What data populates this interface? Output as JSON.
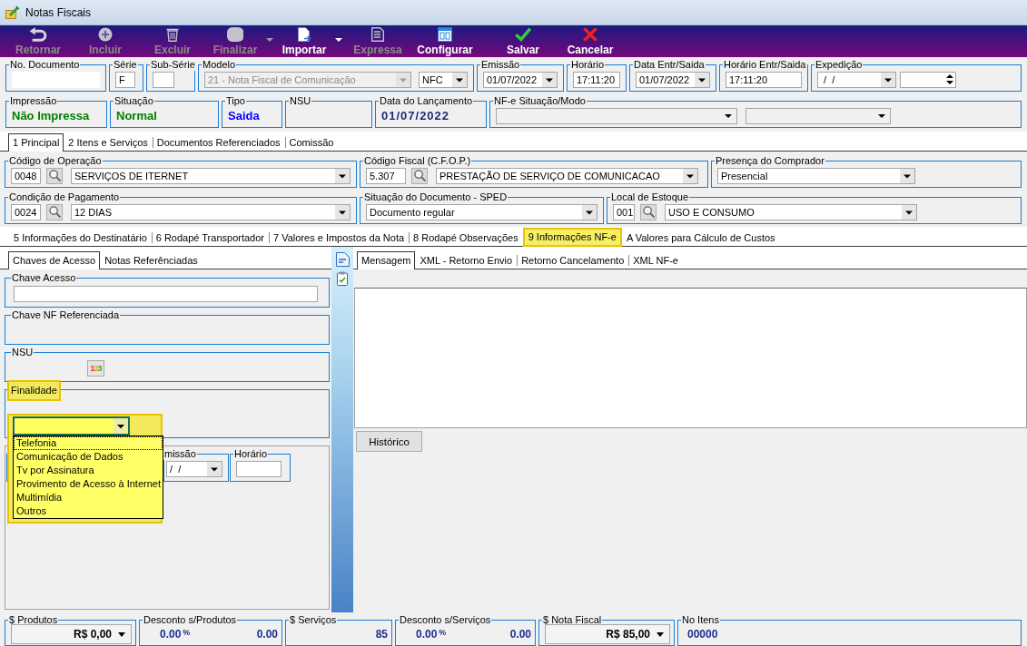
{
  "window": {
    "title": "Notas Fiscais"
  },
  "toolbar": [
    {
      "kind": "undo",
      "label": "Retornar",
      "disabled": true,
      "has_menu": false
    },
    {
      "kind": "add",
      "label": "Incluir",
      "disabled": true,
      "has_menu": false
    },
    {
      "kind": "delete",
      "label": "Excluir",
      "disabled": true,
      "has_menu": false
    },
    {
      "kind": "finish",
      "label": "Finalizar",
      "disabled": true,
      "has_menu": true
    },
    {
      "kind": "import",
      "label": "Importar",
      "disabled": false,
      "has_menu": true
    },
    {
      "kind": "express",
      "label": "Expressa",
      "disabled": true,
      "has_menu": false
    },
    {
      "kind": "configure",
      "label": "Configurar",
      "disabled": false,
      "has_menu": false
    },
    {
      "kind": "save",
      "label": "Salvar",
      "disabled": false,
      "has_menu": false
    },
    {
      "kind": "cancel",
      "label": "Cancelar",
      "disabled": false,
      "has_menu": false
    }
  ],
  "header": [
    {
      "label": "No. Documento",
      "fields": [
        {
          "kind": "text"
        }
      ]
    },
    {
      "label": "Série",
      "fields": [
        {
          "kind": "text",
          "value": "F"
        }
      ]
    },
    {
      "label": "Sub-Série",
      "fields": [
        {
          "kind": "text"
        }
      ]
    },
    {
      "label": "Modelo",
      "fields": [
        {
          "kind": "combo",
          "value": "21 - Nota Fiscal de Comunicação",
          "disabled": true
        },
        {
          "kind": "combo",
          "value": "NFC",
          "disabled": false
        }
      ]
    },
    {
      "label": "Emissão",
      "fields": [
        {
          "kind": "combo",
          "value": "01/07/2022"
        }
      ]
    },
    {
      "label": "Horário",
      "fields": [
        {
          "kind": "text",
          "value": "17:11:20"
        }
      ]
    },
    {
      "label": "Data Entr/Saida",
      "fields": [
        {
          "kind": "combo",
          "value": "01/07/2022"
        }
      ]
    },
    {
      "label": "Horário Entr/Saida",
      "fields": [
        {
          "kind": "text",
          "value": "17:11:20"
        }
      ]
    },
    {
      "label": "Expedição",
      "fields": [
        {
          "kind": "combo",
          "value": " /  /"
        },
        {
          "kind": "spin"
        }
      ]
    }
  ],
  "status": [
    {
      "label": "Impressão",
      "fields": [
        {
          "kind": "display",
          "value": "Não Impressa",
          "color": "#008000"
        }
      ]
    },
    {
      "label": "Situação",
      "fields": [
        {
          "kind": "display",
          "value": "Normal",
          "color": "#008000"
        }
      ]
    },
    {
      "label": "Tipo",
      "fields": [
        {
          "kind": "display",
          "value": "Saida",
          "color": "#0000ff"
        }
      ]
    },
    {
      "label": "NSU"
    },
    {
      "label": "Data do Lançamento",
      "fields": [
        {
          "kind": "display",
          "value": "01/07/2022",
          "color": "#1f2a7a"
        }
      ]
    },
    {
      "label": "NF-e Situação/Modo",
      "fields": [
        {
          "kind": "flat_combo"
        },
        {
          "kind": "flat_combo"
        }
      ]
    }
  ],
  "tabs": [
    {
      "label": "1 Principal",
      "selected": true
    },
    {
      "label": "2 Itens e Serviços",
      "selected": false
    },
    {
      "label": "Documentos Referenciados",
      "selected": false
    },
    {
      "label": "Comissão",
      "selected": false
    }
  ],
  "principal_panel": {
    "rows": [
      {
        "groups": [
          {
            "label": "Código de Operação",
            "fields": [
              {
                "kind": "text",
                "value": "0048"
              },
              {
                "kind": "lookup"
              },
              {
                "kind": "combo",
                "value": "SERVIÇOS DE ITERNET"
              }
            ]
          },
          {
            "label": "Código Fiscal (C.F.O.P.)",
            "fields": [
              {
                "kind": "text",
                "value": "5.307"
              },
              {
                "kind": "lookup"
              },
              {
                "kind": "combo",
                "value": "PRESTAÇÃO DE SERVIÇO DE COMUNICACAO"
              }
            ]
          },
          {
            "label": "Presença do Comprador",
            "fields": [
              {
                "kind": "combo",
                "value": "Presencial"
              }
            ]
          }
        ]
      },
      {
        "groups": [
          {
            "label": "Condição de Pagamento",
            "fields": [
              {
                "kind": "text",
                "value": "0024"
              },
              {
                "kind": "lookup"
              },
              {
                "kind": "combo",
                "value": "12 DIAS"
              }
            ]
          },
          {
            "label": "Situação do Documento - SPED",
            "fields": [
              {
                "kind": "combo",
                "value": "Documento regular"
              }
            ]
          },
          {
            "label": "Local de Estoque",
            "fields": [
              {
                "kind": "text",
                "value": "001"
              },
              {
                "kind": "lookup"
              },
              {
                "kind": "combo",
                "value": "USO E CONSUMO"
              }
            ]
          }
        ]
      }
    ]
  },
  "sub_tabs": [
    {
      "label": "5 Informações do Destinatário",
      "selected": false
    },
    {
      "label": "6 Rodapé Transportador",
      "selected": false
    },
    {
      "label": "7 Valores e Impostos da Nota",
      "selected": false
    },
    {
      "label": "8 Rodapé Observações",
      "selected": false
    },
    {
      "label": "9 Informações NF-e",
      "selected": true
    },
    {
      "label": "A Valores para Cálculo de Custos",
      "selected": false
    }
  ],
  "access_panel": {
    "tabs": [
      {
        "label": "Chaves de Acesso",
        "selected": true
      },
      {
        "label": "Notas Referênciadas",
        "selected": false
      }
    ],
    "groups": [
      {
        "label": "Chave Acesso",
        "highlighted": false,
        "fields": [
          {
            "kind": "text"
          }
        ]
      },
      {
        "label": "Chave NF Referenciada",
        "highlighted": false
      },
      {
        "label": "NSU",
        "highlighted": false,
        "fields": [
          {
            "kind": "sequence",
            "label": "123"
          }
        ]
      },
      {
        "label": "Finalidade",
        "highlighted": true,
        "fields": [
          {
            "kind": "list_combo",
            "highlighted": true,
            "expanded": true,
            "options": [
              {
                "label": "Telefonia",
                "selected": true
              },
              {
                "label": "Comunicação de Dados",
                "selected": false
              },
              {
                "label": "Tv por Assinatura",
                "selected": false
              },
              {
                "label": "Provimento de Acesso à Internet",
                "selected": false
              },
              {
                "label": "Multimídia",
                "selected": false
              },
              {
                "label": "Outros",
                "selected": false
              }
            ]
          }
        ]
      }
    ],
    "date_groups": [
      {
        "label": "missão",
        "fields": [
          {
            "kind": "combo",
            "value": "/  /"
          }
        ]
      },
      {
        "label": "Horário",
        "fields": [
          {
            "kind": "text"
          }
        ]
      }
    ]
  },
  "message_panel": {
    "tabs": [
      {
        "label": "Mensagem",
        "selected": true
      },
      {
        "label": "XML - Retorno Envio",
        "selected": false
      },
      {
        "label": "Retorno Cancelamento",
        "selected": false
      },
      {
        "label": "XML NF-e",
        "selected": false
      }
    ],
    "button": {
      "label": "Histórico"
    }
  },
  "totals": [
    {
      "label": "$ Produtos",
      "fields": [
        {
          "kind": "amount_combo",
          "value": "R$ 0,00"
        }
      ]
    },
    {
      "label": "Desconto s/Produtos",
      "fields": [
        {
          "kind": "percent",
          "value": "0.00",
          "unit": "%"
        },
        {
          "kind": "amount",
          "value": "0.00"
        }
      ]
    },
    {
      "label": "$ Serviços",
      "fields": [
        {
          "kind": "amount",
          "value": "85"
        }
      ]
    },
    {
      "label": "Desconto s/Serviços",
      "fields": [
        {
          "kind": "percent",
          "value": "0.00",
          "unit": "%"
        },
        {
          "kind": "amount",
          "value": "0.00"
        }
      ]
    },
    {
      "label": "$ Nota Fiscal",
      "fields": [
        {
          "kind": "amount_combo",
          "value": "R$ 85,00"
        }
      ]
    },
    {
      "label": "No Itens",
      "fields": [
        {
          "kind": "count",
          "value": "00000"
        }
      ]
    }
  ]
}
